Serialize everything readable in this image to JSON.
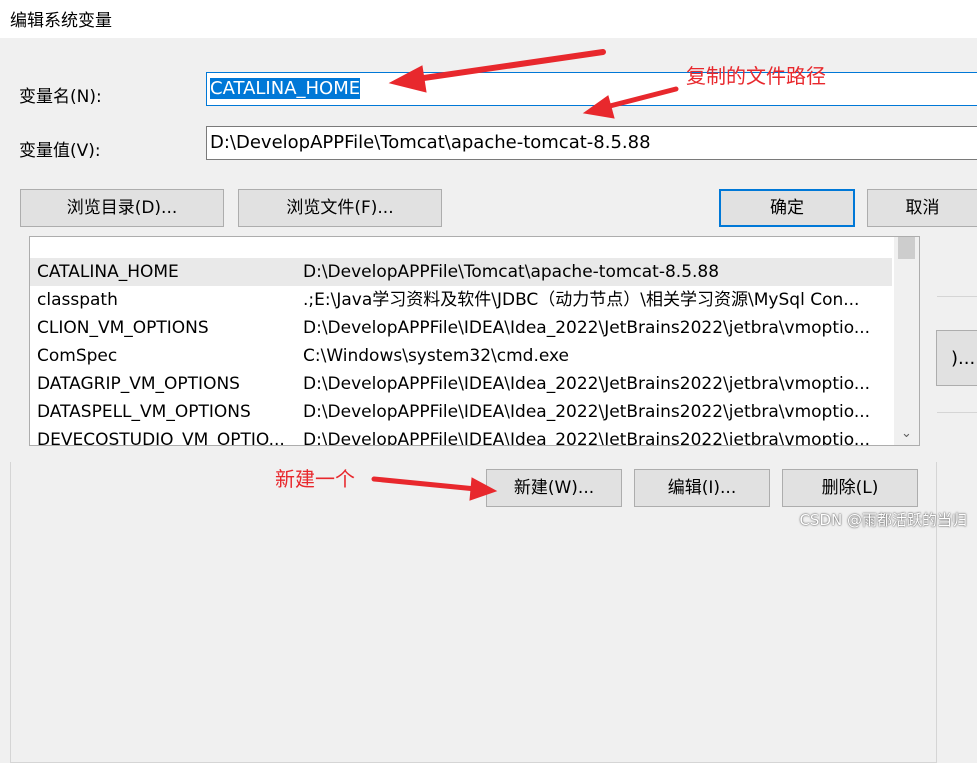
{
  "dialog": {
    "title": "编辑系统变量",
    "name_label": "变量名(N):",
    "name_value": "CATALINA_HOME",
    "value_label": "变量值(V):",
    "value_value": "D:\\DevelopAPPFile\\Tomcat\\apache-tomcat-8.5.88",
    "browse_dir_button": "浏览目录(D)...",
    "browse_file_button": "浏览文件(F)...",
    "ok_button": "确定",
    "cancel_button": "取消"
  },
  "system_variables": {
    "rows": [
      {
        "name": "CATALINA_HOME",
        "value": "D:\\DevelopAPPFile\\Tomcat\\apache-tomcat-8.5.88"
      },
      {
        "name": "classpath",
        "value": ".;E:\\Java学习资料及软件\\JDBC（动力节点）\\相关学习资源\\MySql Con..."
      },
      {
        "name": "CLION_VM_OPTIONS",
        "value": "D:\\DevelopAPPFile\\IDEA\\Idea_2022\\JetBrains2022\\jetbra\\vmoptio..."
      },
      {
        "name": "ComSpec",
        "value": "C:\\Windows\\system32\\cmd.exe"
      },
      {
        "name": "DATAGRIP_VM_OPTIONS",
        "value": "D:\\DevelopAPPFile\\IDEA\\Idea_2022\\JetBrains2022\\jetbra\\vmoptio..."
      },
      {
        "name": "DATASPELL_VM_OPTIONS",
        "value": "D:\\DevelopAPPFile\\IDEA\\Idea_2022\\JetBrains2022\\jetbra\\vmoptio..."
      },
      {
        "name": "DEVECOSTUDIO_VM_OPTIO...",
        "value": "D:\\DevelopAPPFile\\IDEA\\Idea_2022\\JetBrains2022\\jetbra\\vmoptio..."
      }
    ],
    "new_button": "新建(W)...",
    "edit_button": "编辑(I)...",
    "delete_button": "删除(L)",
    "side_button": ")..."
  },
  "annotations": {
    "copy_path": "复制的文件路径",
    "new_one": "新建一个"
  },
  "watermark": "CSDN @雨都活跃的当归",
  "colors": {
    "accent": "#0078d7",
    "annotation": "#e8282d"
  }
}
